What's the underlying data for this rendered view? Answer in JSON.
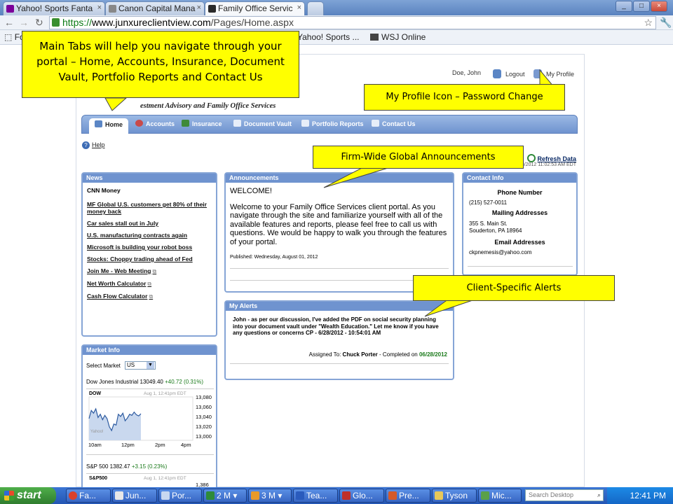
{
  "browser": {
    "tabs": [
      {
        "label": "Yahoo! Sports Fanta",
        "icon_color": "#7b0099"
      },
      {
        "label": "Canon Capital Mana",
        "icon_color": "#888888"
      },
      {
        "label": "Family Office Servic",
        "icon_color": "#2a2a2a"
      }
    ],
    "url_https": "https://",
    "url_domain": "www.junxureclientview.com",
    "url_path": "/Pages/Home.aspx",
    "bookmarks": [
      "Fo",
      "Yahoo! Sports ...",
      "WSJ Online"
    ]
  },
  "portal": {
    "user_name": "Doe, John",
    "logout_label": "Logout",
    "profile_label": "My Profile",
    "firm_name": "estment Advisory and Family Office Services",
    "nav_tabs": [
      "Home",
      "Accounts",
      "Insurance",
      "Document Vault",
      "Portfolio Reports",
      "Contact Us"
    ],
    "help_label": "Help",
    "refresh_label": "Refresh Data",
    "last_updated": "08/2012 11:02:53 AM EDT",
    "news": {
      "title": "News",
      "heading": "CNN Money",
      "items": [
        "MF Global U.S. customers get 80% of their money back",
        "Car sales stall out in July",
        "U.S. manufacturing contracts again",
        "Microsoft is building your robot boss",
        "Stocks: Choppy trading ahead of Fed",
        "Join Me - Web Meeting",
        "Net Worth Calculator",
        "Cash Flow Calculator"
      ]
    },
    "announcements": {
      "title": "Announcements",
      "welcome": "WELCOME!",
      "body": "Welcome to your Family Office Services client portal. As you navigate through the site and familiarize yourself with all of the available features and reports, please feel free to call us with questions. We would be happy to walk you through the features of your portal.",
      "published": "Published: Wednesday, August 01, 2012"
    },
    "alerts": {
      "title": "My Alerts",
      "body": "John - as per our discussion, I've added the PDF on social security planning into your document vault under \"Wealth Education.\" Let me know if you have any questions or concerns CP - 6/28/2012 - 10:54:01 AM",
      "assigned_prefix": "Assigned To:",
      "assigned_name": "Chuck Porter",
      "completed_prefix": "- Completed on",
      "completed_date": "06/28/2012"
    },
    "contact": {
      "title": "Contact Info",
      "phone_heading": "Phone Number",
      "phone": "(215) 527-0011",
      "mail_heading": "Mailing Addresses",
      "address_line1": "355 S. Main St.",
      "address_line2": "Souderton, PA 18964",
      "email_heading": "Email Addresses",
      "email": "ckpnemesis@yahoo.com"
    },
    "market": {
      "title": "Market Info",
      "select_label": "Select Market",
      "selected_market": "US",
      "dow_label": "Dow Jones Industrial",
      "dow_value": "13049.40",
      "dow_change": "+40.72 (0.31%)",
      "chart_symbol": "DOW",
      "chart_time": "Aug 1, 12:41pm EDT",
      "y_ticks": [
        "13,080",
        "13,060",
        "13,040",
        "13,020",
        "13,000"
      ],
      "x_ticks": [
        "10am",
        "12pm",
        "2pm",
        "4pm"
      ],
      "watermark": "Yahoo!",
      "sp_label": "S&P 500",
      "sp_value": "1382.47",
      "sp_change": "+3.15 (0.23%)",
      "sp_symbol": "S&P500",
      "sp_time": "Aug 1, 12:41pm EDT",
      "sp_tick": "1,386"
    }
  },
  "chart_data": {
    "type": "line",
    "title": "DOW",
    "xlabel": "",
    "ylabel": "",
    "x_ticks": [
      "10am",
      "12pm",
      "2pm",
      "4pm"
    ],
    "ylim": [
      13000,
      13080
    ],
    "series": [
      {
        "values": [
          13040,
          13055,
          13050,
          13058,
          13042,
          13048,
          13038,
          13046,
          13040,
          13025,
          13018,
          13030,
          13028,
          13048,
          13044,
          13050,
          13036,
          13041,
          13048,
          13046,
          13052,
          13047,
          13045,
          13049
        ]
      }
    ]
  },
  "callouts": {
    "main_tabs": "Main Tabs will help you navigate through your portal – Home, Accounts, Insurance, Document Vault, Portfolio Reports and Contact Us",
    "my_profile": "My Profile  Icon – Password Change",
    "announcements": "Firm-Wide Global Announcements",
    "alerts": "Client-Specific Alerts"
  },
  "taskbar": {
    "start_label": "start",
    "items": [
      "Fa...",
      "Jun...",
      "Por...",
      "2 M",
      "3 M",
      "Tea...",
      "Glo...",
      "Pre...",
      "Tyson",
      "Mic..."
    ],
    "search_placeholder": "Search Desktop",
    "clock": "12:41 PM"
  },
  "colors": {
    "nav_blue": "#6f93cf",
    "callout_yellow": "#ffff00",
    "positive_green": "#1a7a1a"
  }
}
